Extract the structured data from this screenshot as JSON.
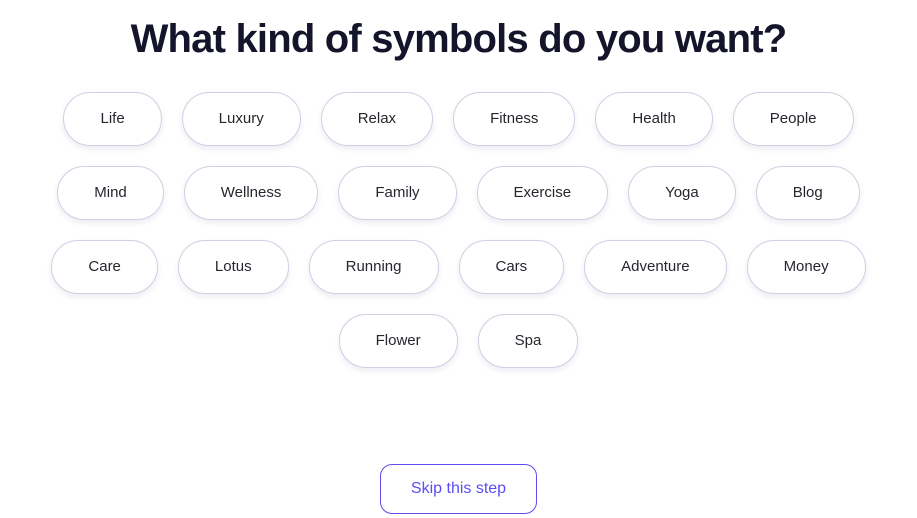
{
  "header": {
    "title": "What kind of symbols do you want?"
  },
  "chips": {
    "rows": [
      [
        {
          "label": "Life"
        },
        {
          "label": "Luxury"
        },
        {
          "label": "Relax"
        },
        {
          "label": "Fitness"
        },
        {
          "label": "Health"
        },
        {
          "label": "People"
        }
      ],
      [
        {
          "label": "Mind"
        },
        {
          "label": "Wellness"
        },
        {
          "label": "Family"
        },
        {
          "label": "Exercise"
        },
        {
          "label": "Yoga"
        },
        {
          "label": "Blog"
        }
      ],
      [
        {
          "label": "Care"
        },
        {
          "label": "Lotus"
        },
        {
          "label": "Running"
        },
        {
          "label": "Cars"
        },
        {
          "label": "Adventure"
        },
        {
          "label": "Money"
        }
      ],
      [
        {
          "label": "Flower"
        },
        {
          "label": "Spa"
        }
      ]
    ]
  },
  "footer": {
    "skip_label": "Skip this step"
  },
  "colors": {
    "title": "#14142b",
    "chip_border": "#cfd0e3",
    "chip_text": "#26262e",
    "accent": "#5d4def",
    "background": "#ffffff"
  }
}
